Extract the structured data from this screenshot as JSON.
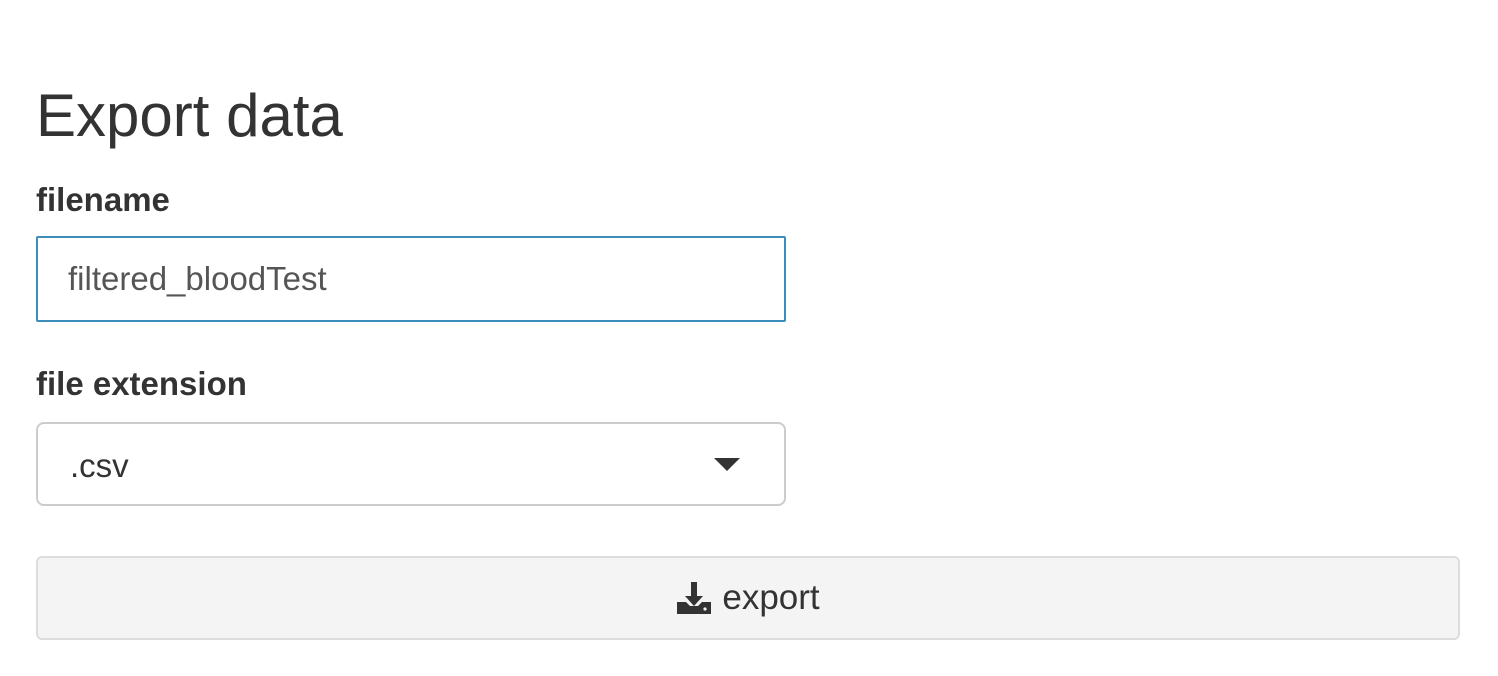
{
  "page": {
    "title": "Export data"
  },
  "filename": {
    "label": "filename",
    "value": "filtered_bloodTest"
  },
  "file_extension": {
    "label": "file extension",
    "selected": ".csv"
  },
  "export_button": {
    "label": "export",
    "icon": "download-icon"
  }
}
